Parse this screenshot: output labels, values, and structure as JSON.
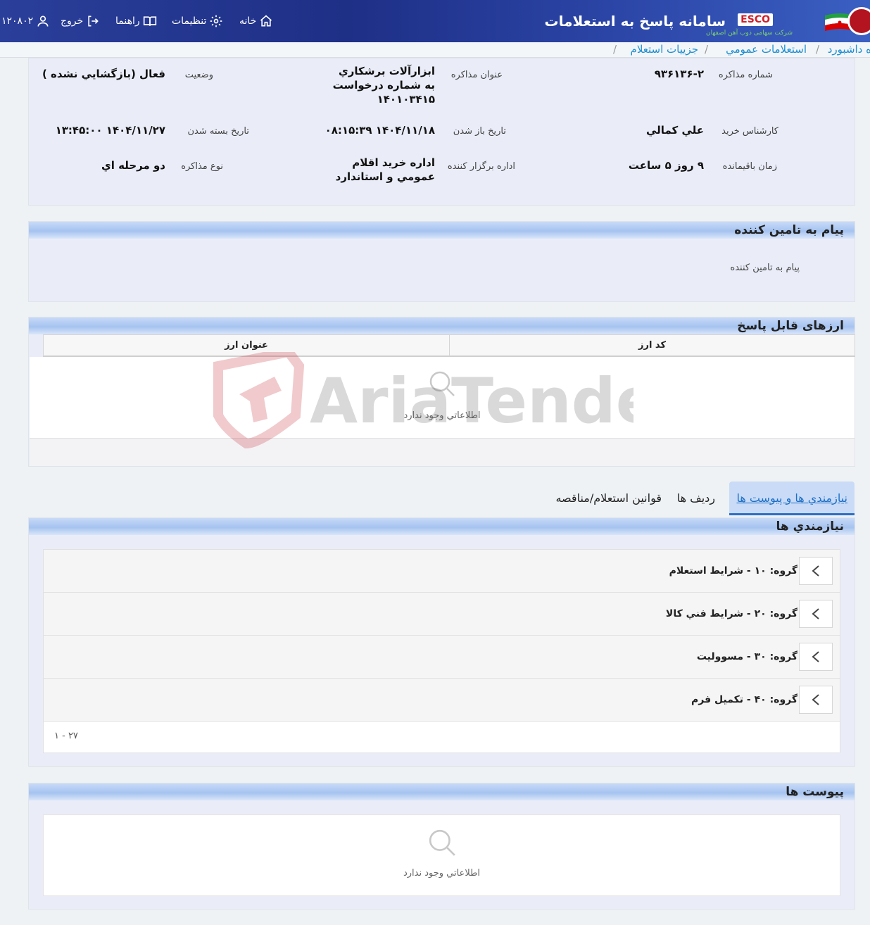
{
  "header": {
    "app_title": "سامانه پاسخ به استعلامات",
    "esco_badge": "ESCO",
    "company_name": "شرکت سهامی ذوب آهن اصفهان",
    "nav": {
      "home": "خانه",
      "settings": "تنظيمات",
      "guide": "راهنما",
      "logout": "خروج",
      "user_id": "۱۲۰۸۰۲"
    }
  },
  "breadcrumb": {
    "dashboard": "ه داشبورد",
    "public_inquiries": "استعلامات عمومي",
    "inquiry_details": "جزييات استعلام",
    "sep": "/"
  },
  "info": {
    "negotiation_number_label": "شماره مذاکره",
    "negotiation_number": "۹۳۶۱۳۶-۲",
    "negotiation_title_label": "عنوان مذاکره",
    "negotiation_title": "ابزارآلات برشکاري به شماره درخواست ۱۴۰۱۰۳۴۱۵",
    "status_label": "وضعيت",
    "status": "فعال (بازگشايي نشده )",
    "buyer_label": "کارشناس خريد",
    "buyer": "علي کمالي",
    "open_date_label": "تاريخ باز شدن",
    "open_date": "۱۴۰۴/۱۱/۱۸ ۰۸:۱۵:۳۹",
    "close_date_label": "تاريخ بسته شدن",
    "close_date": "۱۴۰۴/۱۱/۲۷ ۱۳:۴۵:۰۰",
    "remaining_label": "زمان باقيمانده",
    "remaining": "۹ روز ۵ ساعت",
    "organizer_label": "اداره برگزار کننده",
    "organizer": "اداره خريد اقلام عمومي و استاندارد",
    "type_label": "نوع مذاکره",
    "type": "دو مرحله اي"
  },
  "supplier_message": {
    "title": "پيام به تامين کننده",
    "text": "پيام به تامين کننده"
  },
  "currencies": {
    "title": "ارزهای قابل پاسخ",
    "col_code": "کد ارز",
    "col_name": "عنوان ارز",
    "empty": "اطلاعاتي وجود ندارد"
  },
  "tabs": {
    "requirements": "نيازمندي ها و پيوست ها",
    "rows": "رديف ها",
    "rules": "قوانين استعلام/مناقصه"
  },
  "requirements": {
    "title": "نيازمندي ها",
    "groups": [
      "گروه: ۱۰ - شرايط استعلام",
      "گروه: ۲۰ - شرايط فني کالا",
      "گروه: ۳۰ - مسووليت",
      "گروه: ۴۰ - تکميل فرم"
    ],
    "pager": "۱ - ۲۷"
  },
  "attachments": {
    "title": "پيوست ها",
    "empty": "اطلاعاتي وجود ندارد"
  },
  "watermark": "AriaTender.neT"
}
